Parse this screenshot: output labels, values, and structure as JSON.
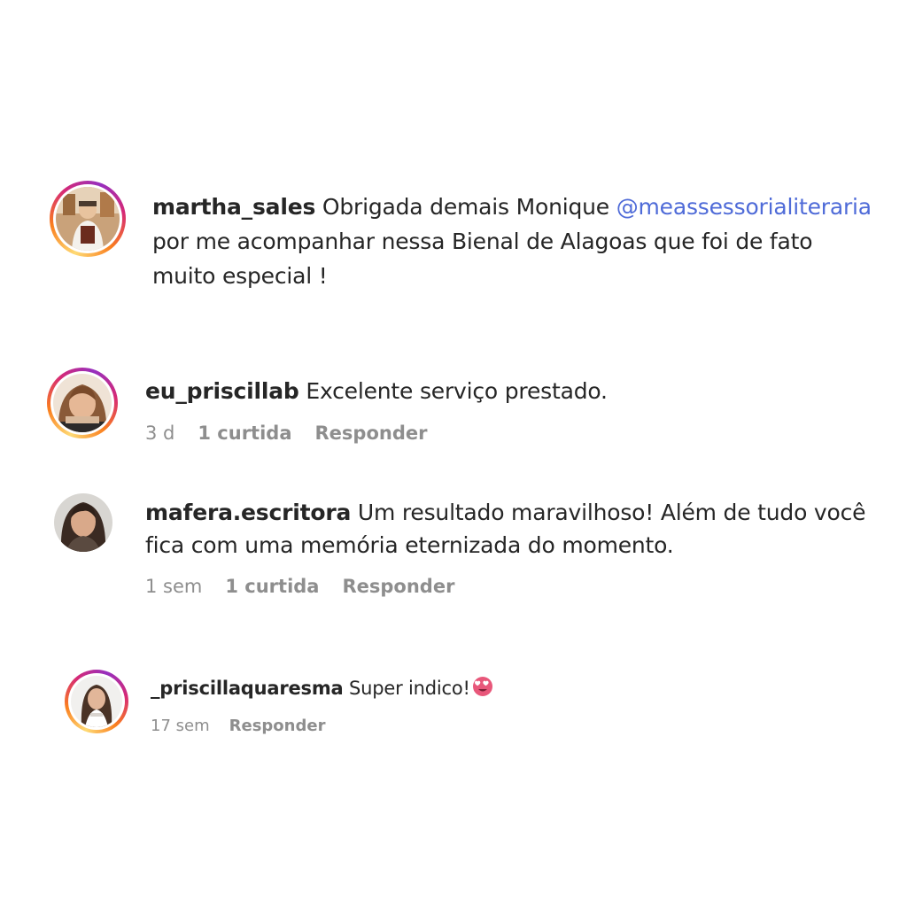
{
  "comments": [
    {
      "username": "martha_sales",
      "text_before": " Obrigada demais Monique ",
      "mention": "@meassessorialiteraria",
      "text_after": " por me acompanhar nessa Bienal de Alagoas que foi de fato muito especial !"
    },
    {
      "username": "eu_priscillab",
      "text": " Excelente serviço prestado.",
      "time": "3 d",
      "likes": "1 curtida",
      "reply": "Responder"
    },
    {
      "username": "mafera.escritora",
      "text": " Um resultado maravilhoso! Além de tudo você fica com uma memória eternizada do momento.",
      "time": "1 sem",
      "likes": "1 curtida",
      "reply": "Responder"
    },
    {
      "username": "_priscillaquaresma",
      "text": " Super indico!",
      "emoji": "smiling-face-with-heart-eyes",
      "time": "17 sem",
      "reply": "Responder"
    }
  ],
  "colors": {
    "text": "#262626",
    "meta": "#8e8e8e",
    "mention": "#4f6bd8"
  }
}
